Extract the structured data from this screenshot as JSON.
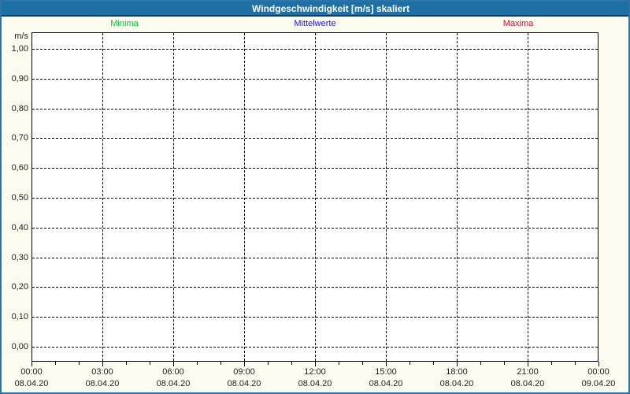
{
  "window": {
    "title": "Windgeschwindigkeit [m/s] skaliert"
  },
  "colors": {
    "frame": "#2c74a8",
    "titlebar_bg": "#1e6fa6",
    "titlebar_separator": "#0f3a62",
    "title_text": "#ffffff",
    "canvas_bg": "#fbfbf0",
    "plot_bg": "#ffffff",
    "grid": "#000000",
    "axis_text": "#1e1e1e",
    "minima_green": "#00c832",
    "mittelwerte_blue": "#1818cc",
    "maxima_red": "#c41238"
  },
  "legend": {
    "items": [
      {
        "label": "Minima",
        "color": "#00c832"
      },
      {
        "label": "Mittelwerte",
        "color": "#1818cc"
      },
      {
        "label": "Maxima",
        "color": "#c41238"
      }
    ]
  },
  "chart_data": {
    "type": "line",
    "title": "Windgeschwindigkeit [m/s] skaliert",
    "ylabel": "m/s",
    "xlabel": "",
    "ylim": [
      0,
      1
    ],
    "ytick_step": 0.1,
    "ytick_labels": [
      "1,00",
      "0,90",
      "0,80",
      "0,70",
      "0,60",
      "0,50",
      "0,40",
      "0,30",
      "0,20",
      "0,10",
      "0,00"
    ],
    "xtick_labels": [
      {
        "time": "00:00",
        "date": "08.04.20"
      },
      {
        "time": "03:00",
        "date": "08.04.20"
      },
      {
        "time": "06:00",
        "date": "08.04.20"
      },
      {
        "time": "09:00",
        "date": "08.04.20"
      },
      {
        "time": "12:00",
        "date": "08.04.20"
      },
      {
        "time": "15:00",
        "date": "08.04.20"
      },
      {
        "time": "18:00",
        "date": "08.04.20"
      },
      {
        "time": "21:00",
        "date": "08.04.20"
      },
      {
        "time": "00:00",
        "date": "09.04.20"
      }
    ],
    "x_major_interval_hours": 3,
    "x_minor_interval_hours": 1,
    "grid": true,
    "legend_position": "top",
    "series": [
      {
        "name": "Minima",
        "color": "#00c832",
        "values": []
      },
      {
        "name": "Mittelwerte",
        "color": "#1818cc",
        "values": []
      },
      {
        "name": "Maxima",
        "color": "#c41238",
        "values": []
      }
    ]
  }
}
